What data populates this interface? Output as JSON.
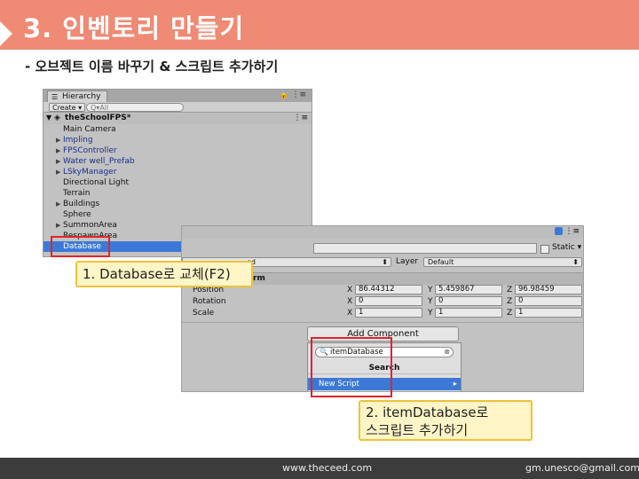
{
  "slide": {
    "title": "3. 인벤토리 만들기",
    "subtitle": "- 오브젝트 이름 바꾸기 & 스크립트 추가하기",
    "footer_site": "www.theceed.com",
    "footer_email": "gm.unesco@gmail.com"
  },
  "hierarchy": {
    "tab_label": "Hierarchy",
    "create_label": "Create ▾",
    "search_placeholder": "Q▾All",
    "scene_name": "theSchoolFPS*",
    "items": [
      {
        "label": "Main Camera",
        "expandable": false,
        "prefab": false
      },
      {
        "label": "Impling",
        "expandable": true,
        "prefab": true
      },
      {
        "label": "FPSController",
        "expandable": true,
        "prefab": true
      },
      {
        "label": "Water well_Prefab",
        "expandable": true,
        "prefab": true
      },
      {
        "label": "LSkyManager",
        "expandable": true,
        "prefab": true
      },
      {
        "label": "Directional Light",
        "expandable": false,
        "prefab": false
      },
      {
        "label": "Terrain",
        "expandable": false,
        "prefab": false
      },
      {
        "label": "Buildings",
        "expandable": true,
        "prefab": false
      },
      {
        "label": "Sphere",
        "expandable": false,
        "prefab": false
      },
      {
        "label": "SummonArea",
        "expandable": true,
        "prefab": false
      },
      {
        "label": "RespawnArea",
        "expandable": false,
        "prefab": false
      },
      {
        "label": "Database",
        "expandable": false,
        "prefab": false,
        "selected": true
      }
    ]
  },
  "inspector": {
    "static_label": "Static ▾",
    "tag_value": "ed",
    "layer_label": "Layer",
    "layer_value": "Default",
    "transform_title": "rm",
    "position_label": "Position",
    "rotation_label": "Rotation",
    "scale_label": "Scale",
    "axis_x": "X",
    "axis_y": "Y",
    "axis_z": "Z",
    "position": {
      "x": "86.44312",
      "y": "5.459867",
      "z": "96.98459"
    },
    "rotation": {
      "x": "0",
      "y": "0",
      "z": "0"
    },
    "scale": {
      "x": "1",
      "y": "1",
      "z": "1"
    },
    "add_component_label": "Add Component",
    "search_value": "itemDatabase",
    "search_heading": "Search",
    "new_script_label": "New Script"
  },
  "callouts": {
    "step1": "1. Database로 교체(F2)",
    "step2_line1": "2. itemDatabase로",
    "step2_line2": "스크립트 추가하기"
  },
  "colors": {
    "header_bg": "#ef8a74",
    "selection_blue": "#3c79d6",
    "highlight_red": "#e0242a",
    "callout_bg": "#fff5c6",
    "callout_border": "#f0c23b",
    "footer_bg": "#3c3c3c"
  }
}
